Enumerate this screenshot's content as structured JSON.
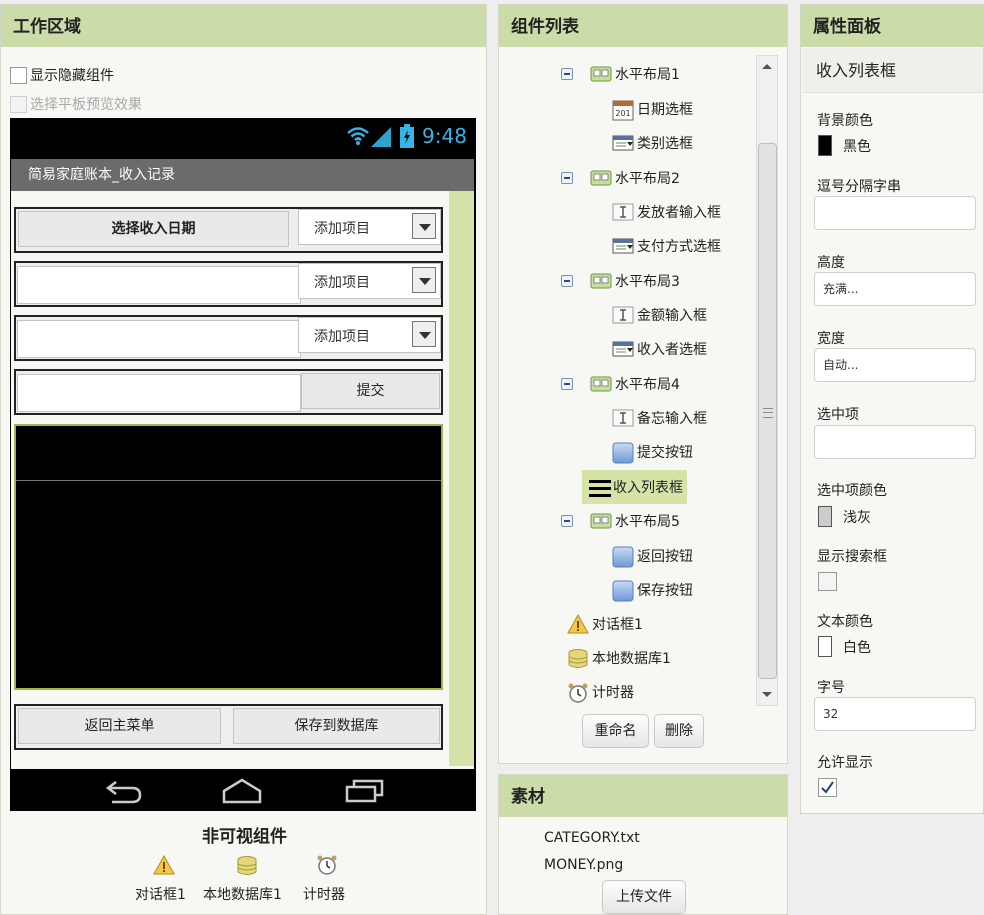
{
  "workspace": {
    "title": "工作区域",
    "show_hidden_label": "显示隐藏组件",
    "tablet_preview_label": "选择平板预览效果",
    "phone": {
      "time": "9:48",
      "app_title": "简易家庭账本_收入记录",
      "date_button": "选择收入日期",
      "spinner_label_1": "添加项目",
      "spinner_label_2": "添加项目",
      "spinner_label_3": "添加项目",
      "submit_button": "提交",
      "back_button": "返回主菜单",
      "save_button": "保存到数据库"
    },
    "nonvisible": {
      "title": "非可视组件",
      "items": [
        "对话框1",
        "本地数据库1",
        "计时器"
      ]
    }
  },
  "components": {
    "title": "组件列表",
    "tree": [
      "水平布局1",
      "日期选框",
      "类别选框",
      "水平布局2",
      "发放者输入框",
      "支付方式选框",
      "水平布局3",
      "金额输入框",
      "收入者选框",
      "水平布局4",
      "备忘输入框",
      "提交按钮",
      "收入列表框",
      "水平布局5",
      "返回按钮",
      "保存按钮",
      "对话框1",
      "本地数据库1",
      "计时器"
    ],
    "rename_button": "重命名",
    "delete_button": "删除"
  },
  "assets": {
    "title": "素材",
    "files": [
      "CATEGORY.txt",
      "MONEY.png"
    ],
    "upload_button": "上传文件"
  },
  "properties": {
    "title": "属性面板",
    "component_name": "收入列表框",
    "bg_color_label": "背景颜色",
    "bg_color_value": "黑色",
    "bg_color_hex": "#000000",
    "separator_label": "逗号分隔字串",
    "separator_value": "",
    "height_label": "高度",
    "height_value": "充满...",
    "width_label": "宽度",
    "width_value": "自动...",
    "selection_label": "选中项",
    "selection_value": "",
    "selection_color_label": "选中项颜色",
    "selection_color_value": "浅灰",
    "selection_color_hex": "#cccccc",
    "show_filter_label": "显示搜索框",
    "show_filter_checked": false,
    "text_color_label": "文本颜色",
    "text_color_value": "白色",
    "text_color_hex": "#ffffff",
    "font_size_label": "字号",
    "font_size_value": "32",
    "visible_label": "允许显示",
    "visible_checked": true
  },
  "colors": {
    "panel_header": "#cbdca9",
    "selected_item": "#d5e2a8",
    "listview_border": "#9bb745"
  }
}
